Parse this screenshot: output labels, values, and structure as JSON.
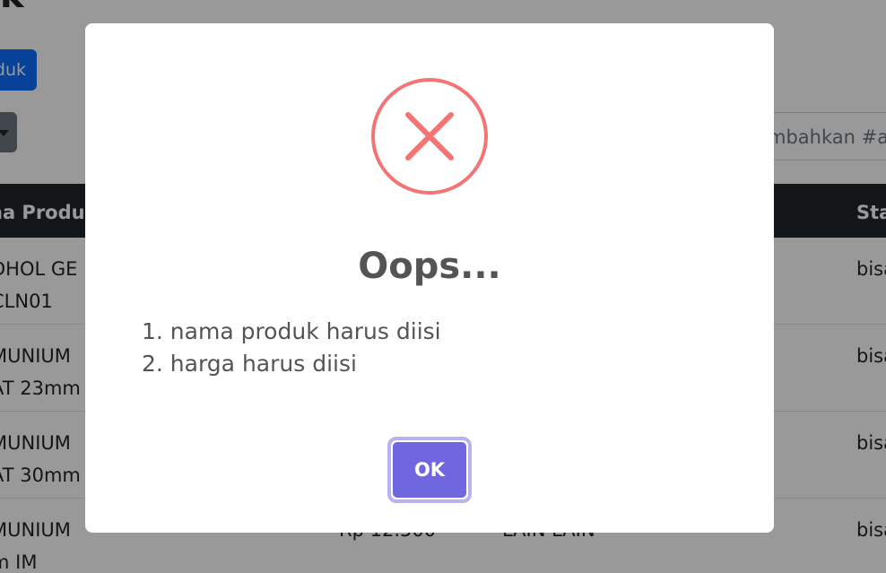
{
  "background": {
    "title_fragment": "k",
    "add_button_label": "duk",
    "search_placeholder_fragment": "mbahkan #a",
    "table": {
      "headers": {
        "name": "na Produ",
        "status": "Sta"
      },
      "rows": [
        {
          "name_line1": "DHOL GE",
          "name_line2": "CLN01",
          "price": "",
          "category": "",
          "status": "bisa"
        },
        {
          "name_line1": "MUNIUM",
          "name_line2": "AT 23mm",
          "price": "",
          "category": "",
          "status": "bisa"
        },
        {
          "name_line1": "MUNIUM",
          "name_line2": "AT 30mm",
          "price": "",
          "category": "",
          "status": "bisa"
        },
        {
          "name_line1": "MUNIUM",
          "name_line2": "m IM",
          "price": "Rp 12.500",
          "category": "LAIN LAIN",
          "status": "bisa"
        }
      ]
    }
  },
  "dialog": {
    "icon": "error-x-icon",
    "icon_color": "#f27474",
    "title": "Oops...",
    "errors": [
      "1. nama produk harus diisi",
      "2. harga harus diisi"
    ],
    "confirm_label": "OK",
    "confirm_color": "#7066e0"
  }
}
